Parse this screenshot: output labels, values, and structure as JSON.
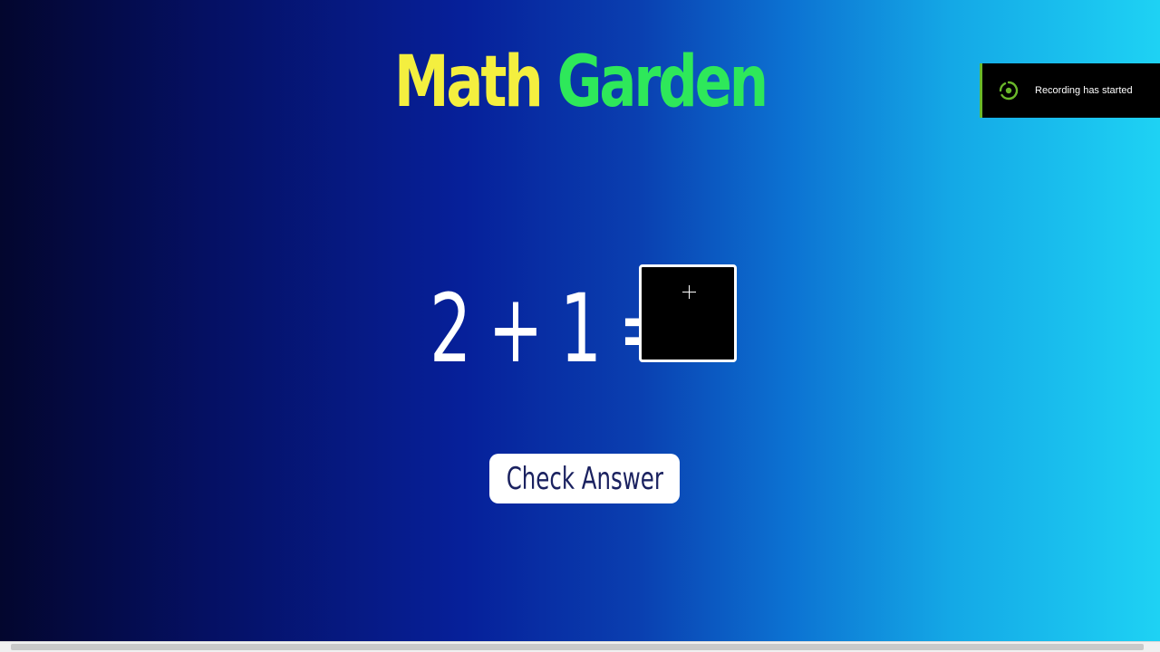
{
  "title": {
    "word1": "Math",
    "word2": "Garden"
  },
  "equation": {
    "operand1": "2",
    "operator": "+",
    "operand2": "1",
    "equals": "="
  },
  "answer_canvas": {
    "icon": "crosshair-cursor-icon"
  },
  "check_button": {
    "label": "Check Answer"
  },
  "notification": {
    "text": "Recording has started",
    "icon": "recording-icon",
    "accent": "#6ab82a"
  },
  "colors": {
    "title_word1": "#f4ef3f",
    "title_word2": "#2ee85a",
    "gradient_left": "#03062e",
    "gradient_right": "#1ed2f4",
    "button_text": "#1b2260"
  }
}
